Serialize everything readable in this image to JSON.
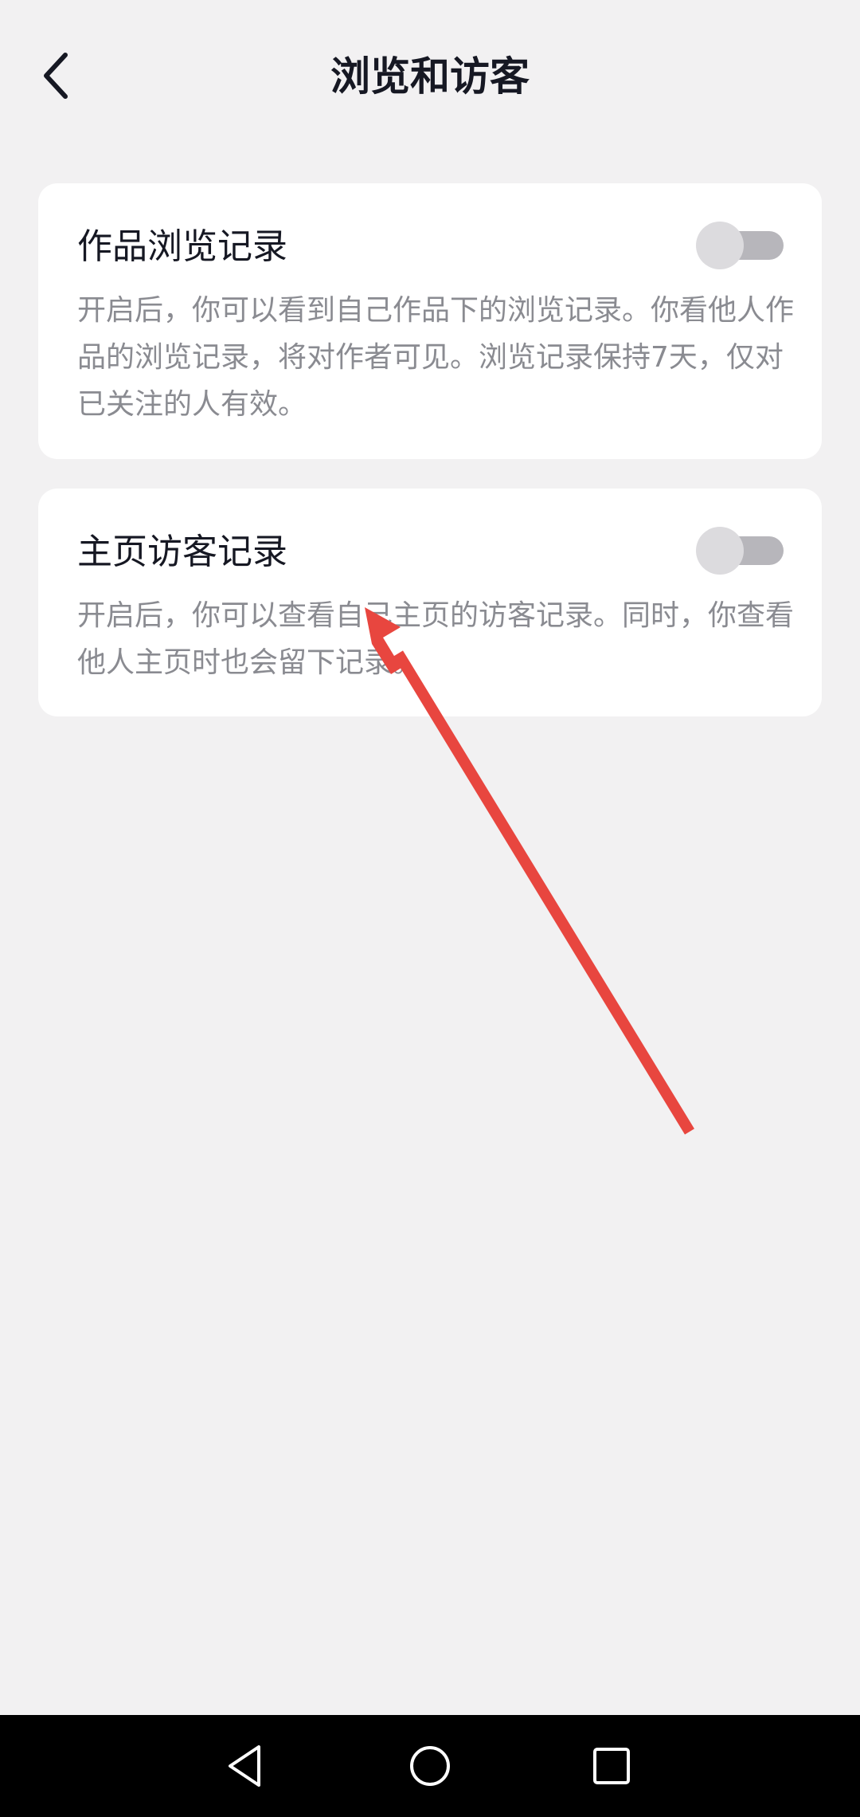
{
  "header": {
    "title": "浏览和访客",
    "back_icon": "chevron-left-icon"
  },
  "settings": [
    {
      "title": "作品浏览记录",
      "description": "开启后，你可以看到自己作品下的浏览记录。你看他人作品的浏览记录，将对作者可见。浏览记录保持7天，仅对已关注的人有效。",
      "enabled": false
    },
    {
      "title": "主页访客记录",
      "description": "开启后，你可以查看自己主页的访客记录。同时，你查看他人主页时也会留下记录。",
      "enabled": false
    }
  ],
  "annotation": {
    "icon": "red-arrow-annotation",
    "color": "#e8463f"
  },
  "navbar": {
    "back_icon": "triangle-back-icon",
    "home_icon": "circle-home-icon",
    "recent_icon": "square-recents-icon"
  },
  "colors": {
    "background": "#f2f1f2",
    "card": "#ffffff",
    "title_text": "#161823",
    "desc_text": "#8a8b91",
    "toggle_track": "#b7b6bb",
    "toggle_knob": "#dcdbde"
  }
}
